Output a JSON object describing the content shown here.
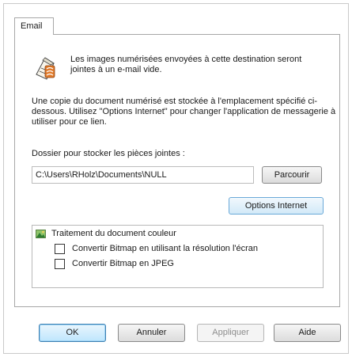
{
  "tab": {
    "label": "Email"
  },
  "intro_text": "Les images numérisées envoyées à cette destination seront jointes à un e-mail vide.",
  "description_text": "Une copie du document numérisé est stockée à l'emplacement spécifié ci-dessous. Utilisez \"Options Internet\" pour changer l'application de messagerie à utiliser pour ce lien.",
  "folder": {
    "label": "Dossier pour stocker les pièces jointes :",
    "value": "C:\\Users\\RHolz\\Documents\\NULL",
    "browse_label": "Parcourir"
  },
  "internet_options_label": "Options Internet",
  "color_processing": {
    "title": "Traitement du document couleur",
    "options": [
      {
        "label": "Convertir Bitmap en utilisant la résolution l'écran",
        "checked": false
      },
      {
        "label": "Convertir Bitmap en JPEG",
        "checked": false
      }
    ]
  },
  "buttons": {
    "ok": "OK",
    "cancel": "Annuler",
    "apply": "Appliquer",
    "help": "Aide"
  },
  "icons": {
    "destination": "email-destination-icon",
    "group": "color-document-icon"
  }
}
